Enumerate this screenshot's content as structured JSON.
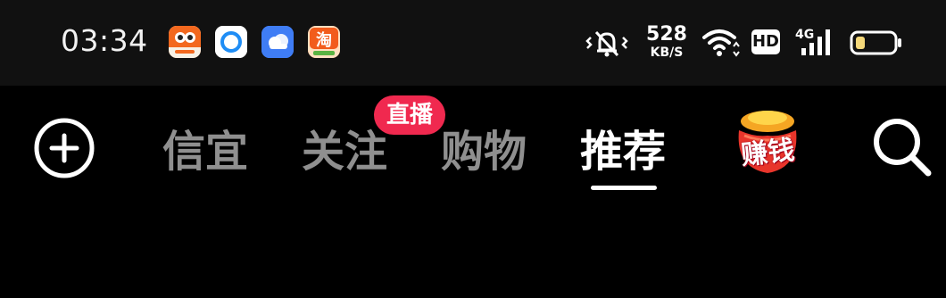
{
  "status_bar": {
    "time": "03:34",
    "apps": [
      {
        "icon": "duorou-app-icon",
        "color": "#f3681e"
      },
      {
        "icon": "ring-app-icon",
        "color": "#ffffff"
      },
      {
        "icon": "cloud-app-icon",
        "color": "#3f7df5"
      },
      {
        "icon": "taobao-app-icon",
        "color": "#f25c1c"
      }
    ],
    "net_speed_value": "528",
    "net_speed_unit": "KB/S",
    "hd_label": "HD",
    "network_label": "4G",
    "icons": [
      "vibrate-mute-icon",
      "wifi-icon",
      "hd-icon",
      "signal-icon",
      "battery-icon"
    ]
  },
  "nav": {
    "tabs": [
      {
        "label": "信宜",
        "active": false
      },
      {
        "label": "关注",
        "active": false
      },
      {
        "label": "购物",
        "active": false
      },
      {
        "label": "推荐",
        "active": true
      }
    ],
    "live_badge": "直播",
    "earn_label": "赚钱",
    "icons": [
      "add-icon",
      "money-bag-icon",
      "search-icon"
    ]
  },
  "colors": {
    "background": "#000000",
    "status_bar": "#111111",
    "inactive_tab": "#8f8f8f",
    "live_badge": "#f0294f",
    "battery_fill": "#f5d87a"
  }
}
